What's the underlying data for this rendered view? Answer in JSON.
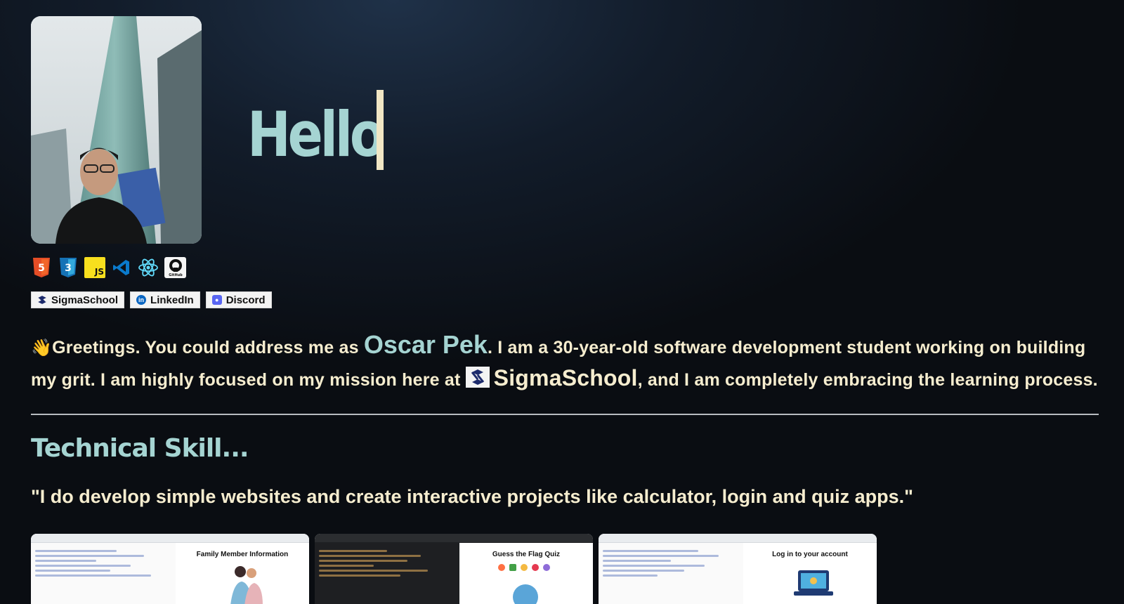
{
  "hero": {
    "greeting": "Hello",
    "photo_alt": "Profile photo in front of a skyscraper"
  },
  "skill_icons": [
    {
      "icon": "html5-icon",
      "label": "5"
    },
    {
      "icon": "css3-icon",
      "label": "3"
    },
    {
      "icon": "javascript-icon",
      "label": "JS"
    },
    {
      "icon": "vscode-icon",
      "label": ""
    },
    {
      "icon": "react-icon",
      "label": ""
    },
    {
      "icon": "github-icon",
      "label": "GitHub"
    }
  ],
  "badges": [
    {
      "icon": "sigmaschool-icon",
      "label": "SigmaSchool"
    },
    {
      "icon": "linkedin-icon",
      "label": "LinkedIn"
    },
    {
      "icon": "discord-icon",
      "label": "Discord"
    }
  ],
  "intro": {
    "wave": "👋",
    "part1": "Greetings. You could address me as ",
    "name": "Oscar Pek",
    "part2": ". I am a 30-year-old software development student working on building my grit. I am highly focused on my mission here at ",
    "school": "SigmaSchool",
    "part3": ", and I am completely embracing the learning process."
  },
  "skills": {
    "heading": "Technical Skill...",
    "quote": "\"I do develop simple websites and create interactive projects like calculator, login and quiz apps.\""
  },
  "projects": [
    {
      "title": "Family Member Information",
      "theme": "light"
    },
    {
      "title": "Guess the Flag Quiz",
      "theme": "dark"
    },
    {
      "title": "Log in to your account",
      "theme": "light"
    }
  ],
  "colors": {
    "accent": "#a5d4d2",
    "text": "#f6edcf",
    "background": "#0a0d12"
  }
}
